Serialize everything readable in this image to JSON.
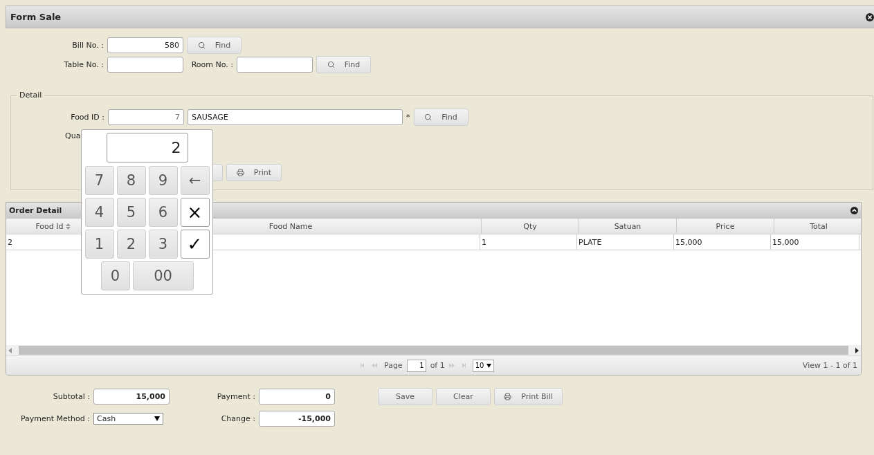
{
  "window": {
    "title": "Form Sale"
  },
  "header_form": {
    "bill_no": {
      "label": "Bill No. :",
      "value": "580"
    },
    "find_bill": "Find",
    "table_no": {
      "label": "Table No. :"
    },
    "room_no": {
      "label": "Room No. :"
    },
    "find_room": "Find"
  },
  "detail": {
    "legend": "Detail",
    "food_id": {
      "label": "Food ID :",
      "value": "7"
    },
    "food_name": "SAUSAGE",
    "required_mark": "*",
    "find_food": "Find",
    "quantity_label": "Qua",
    "print_button": "Print"
  },
  "keypad": {
    "display": "2",
    "keys": [
      {
        "label": "7",
        "kind": "digit"
      },
      {
        "label": "8",
        "kind": "digit"
      },
      {
        "label": "9",
        "kind": "digit"
      },
      {
        "label": "←",
        "kind": "back"
      },
      {
        "label": "4",
        "kind": "digit"
      },
      {
        "label": "5",
        "kind": "digit"
      },
      {
        "label": "6",
        "kind": "digit"
      },
      {
        "label": "×",
        "kind": "action"
      },
      {
        "label": "1",
        "kind": "digit"
      },
      {
        "label": "2",
        "kind": "digit"
      },
      {
        "label": "3",
        "kind": "digit"
      },
      {
        "label": "✓",
        "kind": "action"
      },
      {
        "label": "0",
        "kind": "digit"
      },
      {
        "label": "00",
        "kind": "wide"
      }
    ]
  },
  "order_detail": {
    "title": "Order Detail",
    "columns": [
      "Food Id",
      "Food Name",
      "Qty",
      "Satuan",
      "Price",
      "Total"
    ],
    "rows": [
      [
        "2",
        "",
        "1",
        "PLATE",
        "15,000",
        "15,000"
      ]
    ],
    "pager": {
      "page_label": "Page",
      "page": "1",
      "of": "of 1",
      "page_size": "10",
      "view": "View 1 - 1 of 1"
    }
  },
  "totals": {
    "subtotal": {
      "label": "Subtotal :",
      "value": "15,000"
    },
    "payment": {
      "label": "Payment :",
      "value": "0"
    },
    "payment_method": {
      "label": "Payment Method :",
      "value": "Cash"
    },
    "change": {
      "label": "Change :",
      "value": "-15,000"
    }
  },
  "buttons": [
    {
      "label": "Save",
      "kind": "plain"
    },
    {
      "label": "Clear",
      "kind": "plain"
    },
    {
      "label": "Print Bill",
      "kind": "print"
    }
  ]
}
